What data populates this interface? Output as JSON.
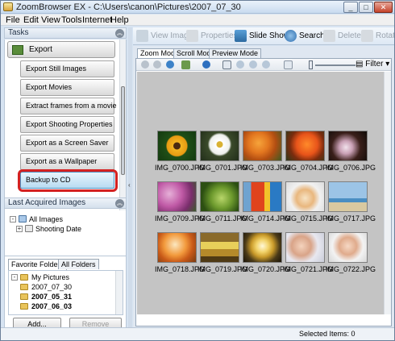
{
  "window": {
    "title": "ZoomBrowser EX  - C:\\Users\\canon\\Pictures\\2007_07_30",
    "min_glyph": "_",
    "max_glyph": "□",
    "close_glyph": "✕"
  },
  "menu": [
    "File",
    "Edit",
    "View",
    "Tools",
    "Internet",
    "Help"
  ],
  "tasks": {
    "header": "Tasks",
    "export_label": "Export",
    "items": [
      "Export Still Images",
      "Export Movies",
      "Extract frames from a movie",
      "Export Shooting Properties",
      "Export as a Screen Saver",
      "Export as a Wallpaper",
      "Backup to CD"
    ],
    "selected_item": "Backup to CD"
  },
  "last_acquired": {
    "header": "Last Acquired Images",
    "tree": [
      {
        "label": "All Images",
        "expander": "-"
      },
      {
        "label": "Shooting Date",
        "expander": "+"
      }
    ]
  },
  "favorites": {
    "tabs": [
      "Favorite Folders",
      "All Folders"
    ],
    "active_tab": "Favorite Folders",
    "tree": [
      {
        "label": "My Pictures",
        "expander": "-"
      },
      {
        "label": "2007_07_30"
      },
      {
        "label": "2007_05_31"
      },
      {
        "label": "2007_06_03"
      }
    ],
    "add_label": "Add...",
    "remove_label": "Remove"
  },
  "toolbar": {
    "view_image": "View Image",
    "properties": "Properties",
    "slide_show": "Slide Show",
    "search": "Search",
    "delete": "Delete",
    "rotate": "Rotat"
  },
  "view_tabs": [
    "Zoom Mode",
    "Scroll Mode",
    "Preview Mode"
  ],
  "active_view_tab": "Zoom Mode",
  "filter_label": "Filter",
  "images": [
    "IMG_0700.JPG",
    "IMG_0701.JPG",
    "IMG_0703.JPG",
    "IMG_0704.JPG",
    "IMG_0706.JPG",
    "IMG_0709.JPG",
    "IMG_0711.JPG",
    "IMG_0714.JPG",
    "IMG_0715.JPG",
    "IMG_0717.JPG",
    "IMG_0718.JPG",
    "IMG_0719.JPG",
    "IMG_0720.JPG",
    "IMG_0721.JPG",
    "IMG_0722.JPG"
  ],
  "status": {
    "selected_items": "Selected Items: 0"
  },
  "colors": {
    "highlight_ring": "#d42121",
    "selection": "#b8dcf2",
    "grid_background": "#c4c4c4"
  }
}
